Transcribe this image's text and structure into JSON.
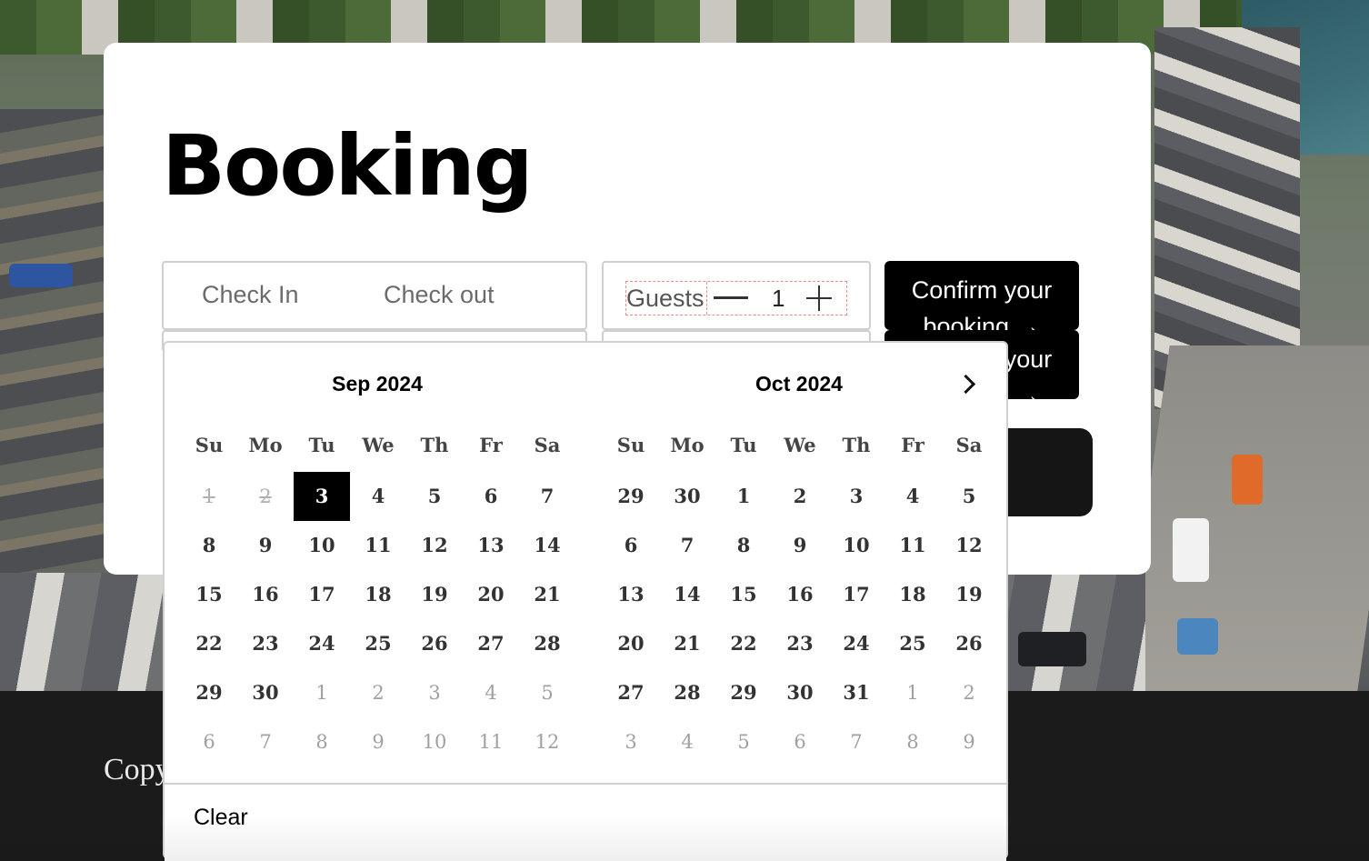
{
  "page": {
    "title": "Booking",
    "footer_text": "Copy"
  },
  "form": {
    "check_in_placeholder": "Check In",
    "check_out_placeholder": "Check out",
    "guests_label": "Guests",
    "guests_count": "1",
    "confirm_label": "Confirm your booking →",
    "confirm_label_duplicate": "Confirm your booking →"
  },
  "datepicker": {
    "months": [
      {
        "title": "Sep 2024",
        "weekdays": [
          "Su",
          "Mo",
          "Tu",
          "We",
          "Th",
          "Fr",
          "Sa"
        ],
        "days": [
          {
            "d": "1",
            "s": "past"
          },
          {
            "d": "2",
            "s": "past"
          },
          {
            "d": "3",
            "s": "selected"
          },
          {
            "d": "4",
            "s": ""
          },
          {
            "d": "5",
            "s": ""
          },
          {
            "d": "6",
            "s": ""
          },
          {
            "d": "7",
            "s": ""
          },
          {
            "d": "8",
            "s": ""
          },
          {
            "d": "9",
            "s": ""
          },
          {
            "d": "10",
            "s": ""
          },
          {
            "d": "11",
            "s": ""
          },
          {
            "d": "12",
            "s": ""
          },
          {
            "d": "13",
            "s": ""
          },
          {
            "d": "14",
            "s": ""
          },
          {
            "d": "15",
            "s": ""
          },
          {
            "d": "16",
            "s": ""
          },
          {
            "d": "17",
            "s": ""
          },
          {
            "d": "18",
            "s": ""
          },
          {
            "d": "19",
            "s": ""
          },
          {
            "d": "20",
            "s": ""
          },
          {
            "d": "21",
            "s": ""
          },
          {
            "d": "22",
            "s": ""
          },
          {
            "d": "23",
            "s": ""
          },
          {
            "d": "24",
            "s": ""
          },
          {
            "d": "25",
            "s": ""
          },
          {
            "d": "26",
            "s": ""
          },
          {
            "d": "27",
            "s": ""
          },
          {
            "d": "28",
            "s": ""
          },
          {
            "d": "29",
            "s": ""
          },
          {
            "d": "30",
            "s": ""
          },
          {
            "d": "1",
            "s": "other"
          },
          {
            "d": "2",
            "s": "other"
          },
          {
            "d": "3",
            "s": "other"
          },
          {
            "d": "4",
            "s": "other"
          },
          {
            "d": "5",
            "s": "other"
          },
          {
            "d": "6",
            "s": "other"
          },
          {
            "d": "7",
            "s": "other"
          },
          {
            "d": "8",
            "s": "other"
          },
          {
            "d": "9",
            "s": "other"
          },
          {
            "d": "10",
            "s": "other"
          },
          {
            "d": "11",
            "s": "other"
          },
          {
            "d": "12",
            "s": "other"
          }
        ]
      },
      {
        "title": "Oct 2024",
        "weekdays": [
          "Su",
          "Mo",
          "Tu",
          "We",
          "Th",
          "Fr",
          "Sa"
        ],
        "days": [
          {
            "d": "29",
            "s": ""
          },
          {
            "d": "30",
            "s": ""
          },
          {
            "d": "1",
            "s": ""
          },
          {
            "d": "2",
            "s": ""
          },
          {
            "d": "3",
            "s": ""
          },
          {
            "d": "4",
            "s": ""
          },
          {
            "d": "5",
            "s": ""
          },
          {
            "d": "6",
            "s": ""
          },
          {
            "d": "7",
            "s": ""
          },
          {
            "d": "8",
            "s": ""
          },
          {
            "d": "9",
            "s": ""
          },
          {
            "d": "10",
            "s": ""
          },
          {
            "d": "11",
            "s": ""
          },
          {
            "d": "12",
            "s": ""
          },
          {
            "d": "13",
            "s": ""
          },
          {
            "d": "14",
            "s": ""
          },
          {
            "d": "15",
            "s": ""
          },
          {
            "d": "16",
            "s": ""
          },
          {
            "d": "17",
            "s": ""
          },
          {
            "d": "18",
            "s": ""
          },
          {
            "d": "19",
            "s": ""
          },
          {
            "d": "20",
            "s": ""
          },
          {
            "d": "21",
            "s": ""
          },
          {
            "d": "22",
            "s": ""
          },
          {
            "d": "23",
            "s": ""
          },
          {
            "d": "24",
            "s": ""
          },
          {
            "d": "25",
            "s": ""
          },
          {
            "d": "26",
            "s": ""
          },
          {
            "d": "27",
            "s": ""
          },
          {
            "d": "28",
            "s": ""
          },
          {
            "d": "29",
            "s": ""
          },
          {
            "d": "30",
            "s": ""
          },
          {
            "d": "31",
            "s": ""
          },
          {
            "d": "1",
            "s": "other"
          },
          {
            "d": "2",
            "s": "other"
          },
          {
            "d": "3",
            "s": "other"
          },
          {
            "d": "4",
            "s": "other"
          },
          {
            "d": "5",
            "s": "other"
          },
          {
            "d": "6",
            "s": "other"
          },
          {
            "d": "7",
            "s": "other"
          },
          {
            "d": "8",
            "s": "other"
          },
          {
            "d": "9",
            "s": "other"
          }
        ]
      }
    ],
    "clear_label": "Clear",
    "next_icon": "chevron-right-icon"
  },
  "colors": {
    "selected_bg": "#000000",
    "button_bg": "#000000",
    "footer_bg": "#1b1b1b"
  }
}
